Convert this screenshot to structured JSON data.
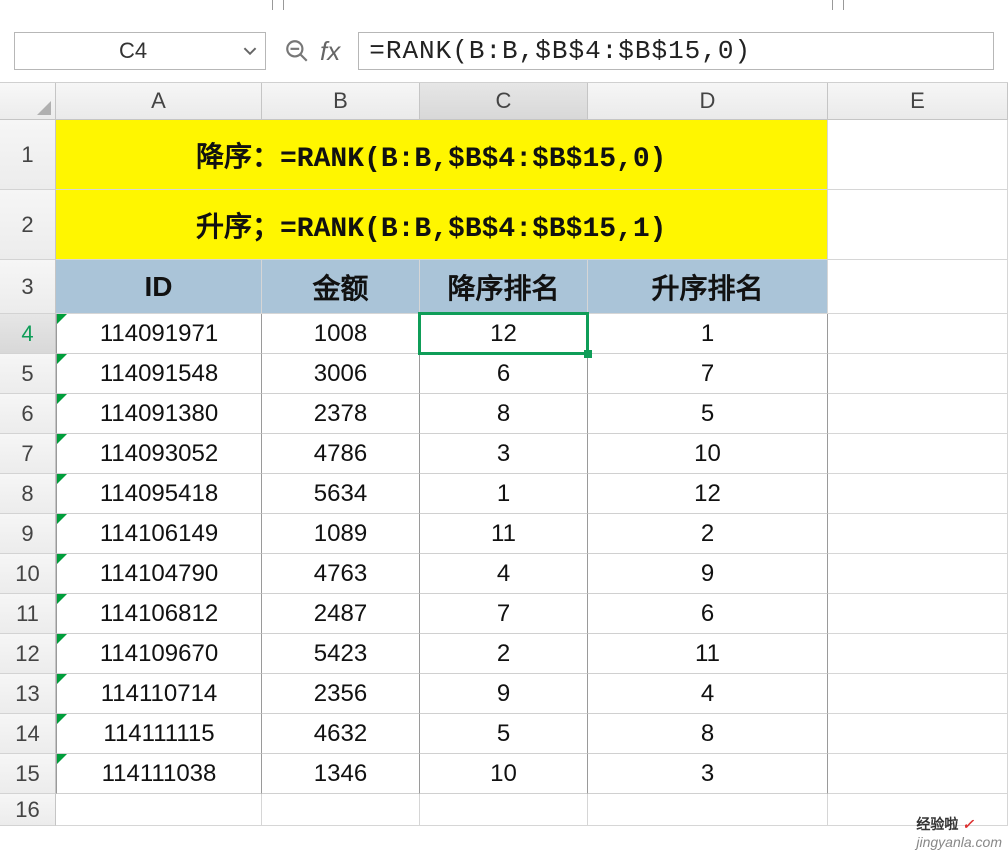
{
  "namebox": {
    "value": "C4"
  },
  "fx": {
    "label": "fx"
  },
  "formula": {
    "value": "=RANK(B:B,$B$4:$B$15,0)"
  },
  "columns": {
    "A": "A",
    "B": "B",
    "C": "C",
    "D": "D",
    "E": "E"
  },
  "row_headers": [
    "1",
    "2",
    "3",
    "4",
    "5",
    "6",
    "7",
    "8",
    "9",
    "10",
    "11",
    "12",
    "13",
    "14",
    "15",
    "16"
  ],
  "banner": {
    "row1": "降序：=RANK(B:B,$B$4:$B$15,0)",
    "row2": "升序；=RANK(B:B,$B$4:$B$15,1)"
  },
  "headers": {
    "A": "ID",
    "B": "金额",
    "C": "降序排名",
    "D": "升序排名"
  },
  "data": [
    {
      "id": "114091971",
      "amount": "1008",
      "desc": "12",
      "asc": "1"
    },
    {
      "id": "114091548",
      "amount": "3006",
      "desc": "6",
      "asc": "7"
    },
    {
      "id": "114091380",
      "amount": "2378",
      "desc": "8",
      "asc": "5"
    },
    {
      "id": "114093052",
      "amount": "4786",
      "desc": "3",
      "asc": "10"
    },
    {
      "id": "114095418",
      "amount": "5634",
      "desc": "1",
      "asc": "12"
    },
    {
      "id": "114106149",
      "amount": "1089",
      "desc": "11",
      "asc": "2"
    },
    {
      "id": "114104790",
      "amount": "4763",
      "desc": "4",
      "asc": "9"
    },
    {
      "id": "114106812",
      "amount": "2487",
      "desc": "7",
      "asc": "6"
    },
    {
      "id": "114109670",
      "amount": "5423",
      "desc": "2",
      "asc": "11"
    },
    {
      "id": "114110714",
      "amount": "2356",
      "desc": "9",
      "asc": "4"
    },
    {
      "id": "114111115",
      "amount": "4632",
      "desc": "5",
      "asc": "8"
    },
    {
      "id": "114111038",
      "amount": "1346",
      "desc": "10",
      "asc": "3"
    }
  ],
  "watermark": {
    "brand": "经验啦",
    "check": "✓",
    "url": "jingyanla.com"
  }
}
